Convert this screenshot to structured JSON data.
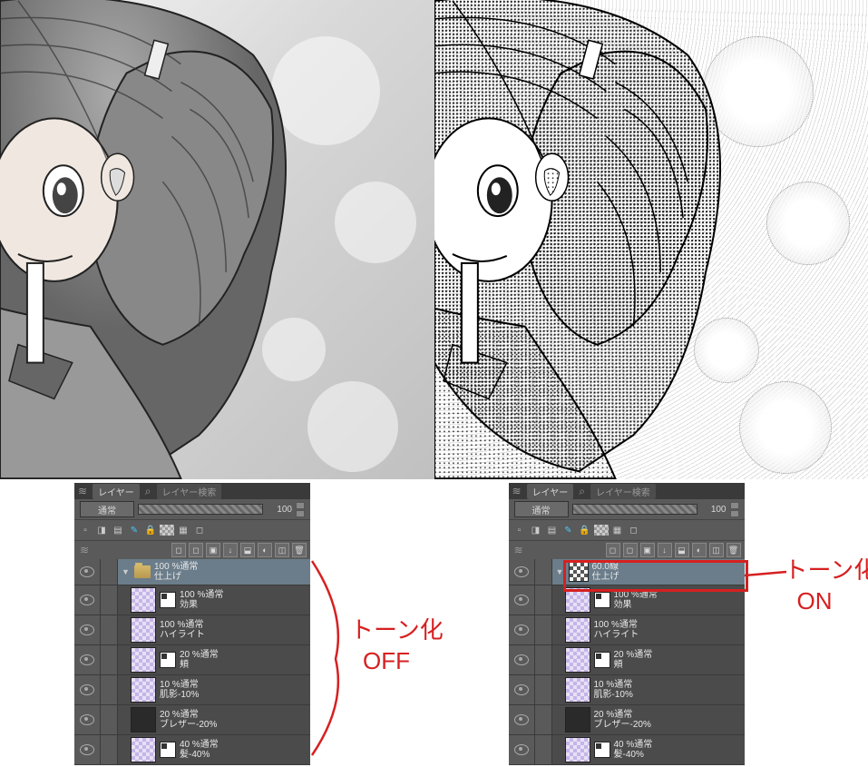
{
  "panel": {
    "tabs": {
      "layers": "レイヤー",
      "search": "レイヤー検索"
    },
    "blend_mode": "通常",
    "opacity": "100",
    "layers_left": [
      {
        "type": "folder",
        "opacity": "100 %通常",
        "name": "仕上げ",
        "selected": true
      },
      {
        "type": "layer",
        "opacity": "100 %通常",
        "name": "効果",
        "thumb": "checker",
        "mask": true,
        "indent": true
      },
      {
        "type": "layer",
        "opacity": "100 %通常",
        "name": "ハイライト",
        "thumb": "checker",
        "indent": true
      },
      {
        "type": "layer",
        "opacity": "20 %通常",
        "name": "頬",
        "thumb": "checker",
        "mask": true,
        "indent": true
      },
      {
        "type": "layer",
        "opacity": "10 %通常",
        "name": "肌影-10%",
        "thumb": "checker",
        "indent": true
      },
      {
        "type": "layer",
        "opacity": "20 %通常",
        "name": "ブレザー-20%",
        "thumb": "dark",
        "indent": true
      },
      {
        "type": "layer",
        "opacity": "40 %通常",
        "name": "髪-40%",
        "thumb": "checker",
        "mask": true,
        "indent": true
      }
    ],
    "layers_right": [
      {
        "type": "folder",
        "opacity": "60.0線",
        "name": "仕上げ",
        "selected": true,
        "tone_thumb": true
      },
      {
        "type": "layer",
        "opacity": "100 %通常",
        "name": "効果",
        "thumb": "checker",
        "mask": true,
        "indent": true
      },
      {
        "type": "layer",
        "opacity": "100 %通常",
        "name": "ハイライト",
        "thumb": "checker",
        "indent": true
      },
      {
        "type": "layer",
        "opacity": "20 %通常",
        "name": "頬",
        "thumb": "checker",
        "mask": true,
        "indent": true
      },
      {
        "type": "layer",
        "opacity": "10 %通常",
        "name": "肌影-10%",
        "thumb": "checker",
        "indent": true
      },
      {
        "type": "layer",
        "opacity": "20 %通常",
        "name": "ブレザー-20%",
        "thumb": "dark",
        "indent": true
      },
      {
        "type": "layer",
        "opacity": "40 %通常",
        "name": "髪-40%",
        "thumb": "checker",
        "mask": true,
        "indent": true
      }
    ]
  },
  "annotations": {
    "left_line1": "トーン化",
    "left_line2": "OFF",
    "right_line1": "トーン化",
    "right_line2": "ON"
  }
}
